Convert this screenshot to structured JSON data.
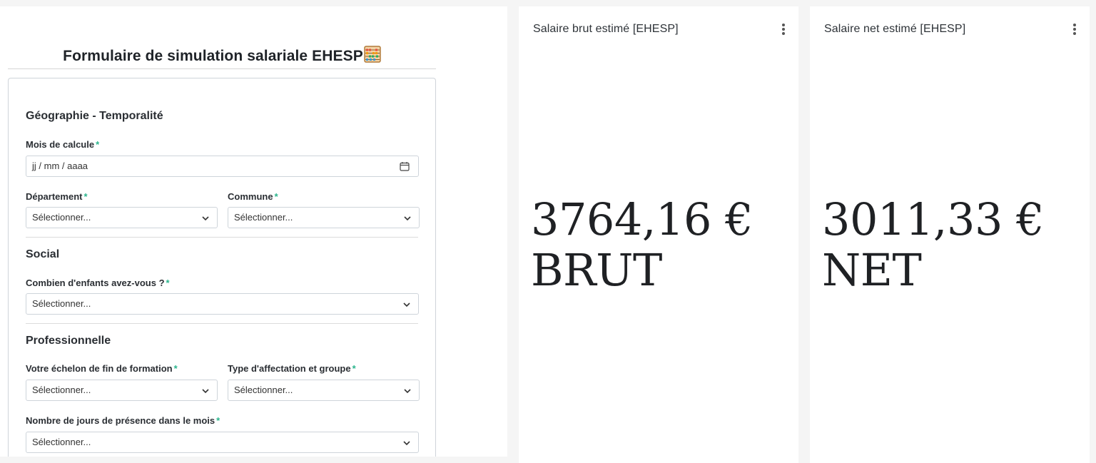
{
  "form": {
    "title": "Formulaire de simulation salariale EHESP",
    "title_icon": "abacus-icon",
    "sections": {
      "geo": "Géographie - Temporalité",
      "social": "Social",
      "pro": "Professionnelle"
    },
    "fields": {
      "mois": {
        "label": "Mois de calcule",
        "required": "*",
        "placeholder": "jj / mm / aaaa"
      },
      "departement": {
        "label": "Département",
        "required": "*",
        "value": "Sélectionner..."
      },
      "commune": {
        "label": "Commune",
        "required": "*",
        "value": "Sélectionner..."
      },
      "enfants": {
        "label": "Combien d'enfants avez-vous ?",
        "required": "*",
        "value": "Sélectionner..."
      },
      "echelon": {
        "label": "Votre échelon de fin de formation",
        "required": "*",
        "value": "Sélectionner..."
      },
      "affectation": {
        "label": "Type d'affectation et groupe",
        "required": "*",
        "value": "Sélectionner..."
      },
      "jours": {
        "label": "Nombre de jours de présence dans le mois",
        "required": "*",
        "value": "Sélectionner..."
      }
    }
  },
  "cards": {
    "brut": {
      "title": "Salaire brut estimé [EHESP]",
      "amount": "3764,16 €",
      "unit": "BRUT"
    },
    "net": {
      "title": "Salaire net estimé [EHESP]",
      "amount": "3011,33 €",
      "unit": "NET"
    }
  },
  "colors": {
    "required_star": "#2bb58d",
    "background": "#f5f5f5",
    "panel": "#ffffff"
  }
}
